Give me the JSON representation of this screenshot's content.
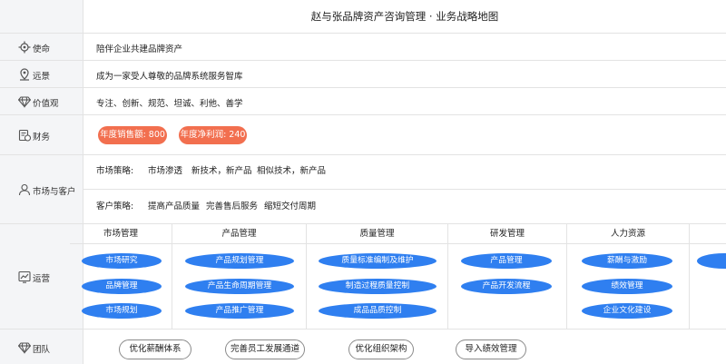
{
  "title": "赵与张品牌资产咨询管理 · 业务战略地图",
  "rows": {
    "mission": {
      "label": "使命",
      "value": "陪伴企业共建品牌资产",
      "icon": "mission-icon"
    },
    "vision": {
      "label": "远景",
      "value": "成为一家受人尊敬的品牌系统服务智库",
      "icon": "vision-icon"
    },
    "values": {
      "label": "价值观",
      "value": "专注、创新、规范、坦诚、利他、善学",
      "icon": "diamond-icon"
    },
    "finance": {
      "label": "财务",
      "icon": "finance-icon",
      "pills": [
        "年度销售额: 800",
        "年度净利润: 240"
      ]
    },
    "market": {
      "label": "市场与客户",
      "icon": "user-icon",
      "strategies": [
        {
          "name": "市场策略:",
          "items": [
            "市场渗透",
            "新技术，新产品",
            "相似技术，新产品"
          ]
        },
        {
          "name": "客户策略:",
          "items": [
            "提高产品质量",
            "完善售后服务",
            "缩短交付周期"
          ]
        }
      ]
    },
    "operations": {
      "label": "运营",
      "icon": "chart-icon",
      "columns": [
        {
          "title": "市场管理",
          "items": [
            "市场研究",
            "品牌管理",
            "市场规划"
          ]
        },
        {
          "title": "产品管理",
          "items": [
            "产品规划管理",
            "产品生命周期管理",
            "产品推广管理"
          ]
        },
        {
          "title": "质量管理",
          "items": [
            "质量标准编制及维护",
            "制造过程质量控制",
            "成品品质控制"
          ]
        },
        {
          "title": "研发管理",
          "items": [
            "产品管理",
            "产品开发流程"
          ]
        },
        {
          "title": "人力资源",
          "items": [
            "薪酬与激励",
            "绩效管理",
            "企业文化建设"
          ]
        }
      ]
    },
    "team": {
      "label": "团队",
      "icon": "diamond-icon",
      "buttons": [
        "优化薪酬体系",
        "完善员工发展通道",
        "优化组织架构",
        "导入绩效管理"
      ]
    }
  },
  "colors": {
    "label_bg": "#f4f5f7",
    "pill": "#f26f4f",
    "oval": "#2f7ff0",
    "border": "#e3e3e3"
  }
}
